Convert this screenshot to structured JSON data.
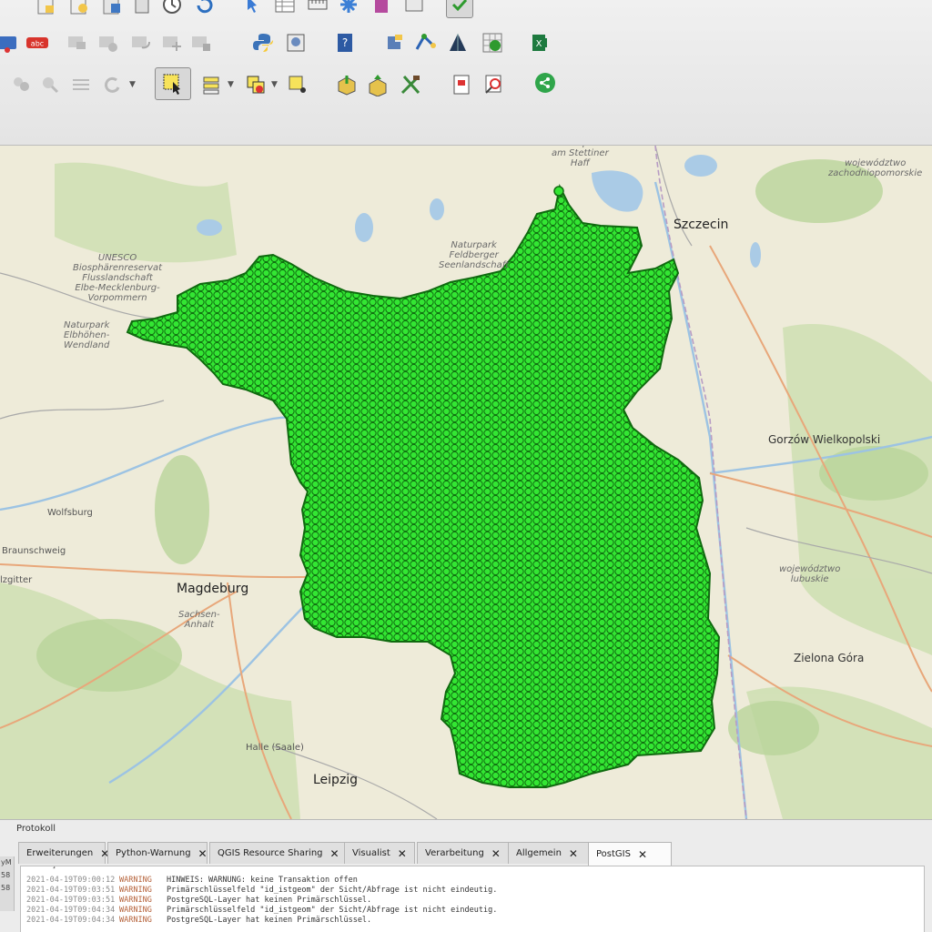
{
  "toolbar": {
    "row1": [
      "project-icon",
      "new-project-icon",
      "save-icon",
      "print-icon",
      "clock-icon",
      "refresh-icon",
      "pan-icon",
      "table-icon",
      "measure-icon",
      "settings-icon",
      "edit-icon",
      "plugin-icon",
      "check-icon"
    ],
    "row2": [
      "label-icon",
      "abc-label-icon",
      "pin-label-icon",
      "show-label-icon",
      "rotate-label-icon",
      "move-label-icon",
      "change-label-icon",
      "python-icon",
      "processing-icon",
      "help-icon",
      "plugin-manager-icon",
      "gps-icon",
      "cone-icon",
      "grid-reload-icon",
      "excel-export-icon"
    ],
    "row3": [
      "digitize-icon",
      "node-icon",
      "vertex-icon",
      "undo-icon",
      "select-features-icon",
      "identify-icon",
      "layer-select-icon",
      "deselect-icon",
      "add-point-icon",
      "import-shape-icon",
      "export-shape-icon",
      "tools-icon",
      "print-layout-icon",
      "spatial-query-icon",
      "share-icon"
    ],
    "label_text": "abc"
  },
  "map": {
    "labels": [
      {
        "id": "stettiner-haff",
        "text": "Naturpark\nam Stettiner\nHaff"
      },
      {
        "id": "szczecin",
        "text": "Szczecin"
      },
      {
        "id": "zachodniopomorskie",
        "text": "województwo\nzachodniopomorskie"
      },
      {
        "id": "feldberger",
        "text": "Naturpark\nFeldberger\nSeenlandschaft"
      },
      {
        "id": "unesco",
        "text": "UNESCO\nBiosphärenreservat\nFlusslandschaft\nElbe-Mecklenburg-\nVorpommern"
      },
      {
        "id": "elbhoehen",
        "text": "Naturpark\nElbhöhen-\nWendland"
      },
      {
        "id": "gorzow",
        "text": "Gorzów Wielkopolski"
      },
      {
        "id": "wolfsburg",
        "text": "Wolfsburg"
      },
      {
        "id": "braunschweig",
        "text": "Braunschweig"
      },
      {
        "id": "salzgitter",
        "text": "lzgitter"
      },
      {
        "id": "magdeburg",
        "text": "Magdeburg"
      },
      {
        "id": "sachsen-anhalt",
        "text": "Sachsen-\nAnhalt"
      },
      {
        "id": "lubuskie",
        "text": "województwo\nlubuskie"
      },
      {
        "id": "zielona-gora",
        "text": "Zielona Góra"
      },
      {
        "id": "halle",
        "text": "Halle (Saale)"
      },
      {
        "id": "leipzig",
        "text": "Leipzig"
      }
    ],
    "layer_color": "#33e633",
    "layer_stroke": "#0f6a0f"
  },
  "panel": {
    "title": "Protokoll",
    "tabs": [
      {
        "label": "Erweiterungen"
      },
      {
        "label": "Python-Warnung"
      },
      {
        "label": "QGIS Resource Sharing"
      },
      {
        "label": "Visualist"
      },
      {
        "label": "Verarbeitung"
      },
      {
        "label": "Allgemein"
      },
      {
        "label": "PostGIS"
      }
    ],
    "active_tab": "PostGIS",
    "log": [
      {
        "ts": "2021-04-19T09:00:12",
        "level": "WARNING",
        "msg": "HINWEIS: WARNUNG: keine Transaktion offen"
      },
      {
        "ts": "2021-04-19T09:03:51",
        "level": "WARNING",
        "msg": "Primärschlüsselfeld \"id_istgeom\" der Sicht/Abfrage ist nicht eindeutig."
      },
      {
        "ts": "2021-04-19T09:03:51",
        "level": "WARNING",
        "msg": "PostgreSQL-Layer hat keinen Primärschlüssel."
      },
      {
        "ts": "2021-04-19T09:04:34",
        "level": "WARNING",
        "msg": "Primärschlüsselfeld \"id_istgeom\" der Sicht/Abfrage ist nicht eindeutig."
      },
      {
        "ts": "2021-04-19T09:04:34",
        "level": "WARNING",
        "msg": "PostgreSQL-Layer hat keinen Primärschlüssel."
      }
    ],
    "bracket": "]",
    "left_stub": [
      "yM",
      "58",
      "58"
    ]
  }
}
